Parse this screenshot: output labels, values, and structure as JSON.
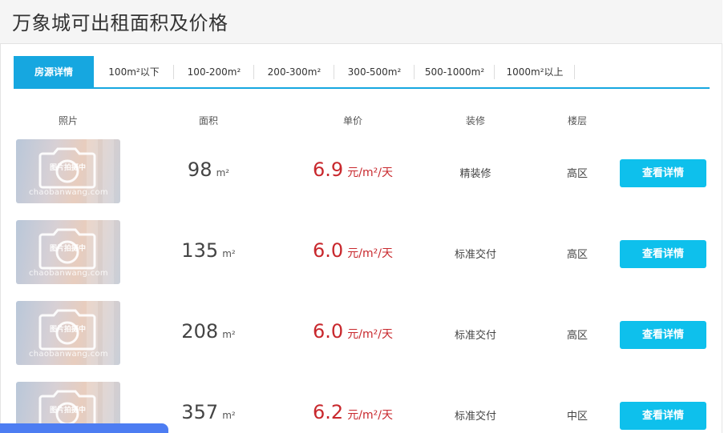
{
  "page": {
    "title": "万象城可出租面积及价格"
  },
  "tabs": [
    {
      "label": "房源详情",
      "active": true
    },
    {
      "label": "100m²以下",
      "active": false
    },
    {
      "label": "100-200m²",
      "active": false
    },
    {
      "label": "200-300m²",
      "active": false
    },
    {
      "label": "300-500m²",
      "active": false
    },
    {
      "label": "500-1000m²",
      "active": false
    },
    {
      "label": "1000m²以上",
      "active": false
    }
  ],
  "columns": {
    "photo": "照片",
    "area": "面积",
    "price": "单价",
    "decoration": "装修",
    "floor": "楼层"
  },
  "thumb_watermark": {
    "main": "图片拍摄中",
    "site": "chaobanwang.com"
  },
  "listings": [
    {
      "area": "98",
      "area_unit": "m²",
      "price": "6.9",
      "price_unit": "元/m²/天",
      "decoration": "精装修",
      "floor": "高区",
      "button": "查看详情"
    },
    {
      "area": "135",
      "area_unit": "m²",
      "price": "6.0",
      "price_unit": "元/m²/天",
      "decoration": "标准交付",
      "floor": "高区",
      "button": "查看详情"
    },
    {
      "area": "208",
      "area_unit": "m²",
      "price": "6.0",
      "price_unit": "元/m²/天",
      "decoration": "标准交付",
      "floor": "高区",
      "button": "查看详情"
    },
    {
      "area": "357",
      "area_unit": "m²",
      "price": "6.2",
      "price_unit": "元/m²/天",
      "decoration": "标准交付",
      "floor": "中区",
      "button": "查看详情"
    }
  ],
  "colors": {
    "accent": "#16a7e0",
    "button": "#0ec0ec",
    "price": "#c8282d",
    "bottom_bar": "#4d7df2"
  }
}
